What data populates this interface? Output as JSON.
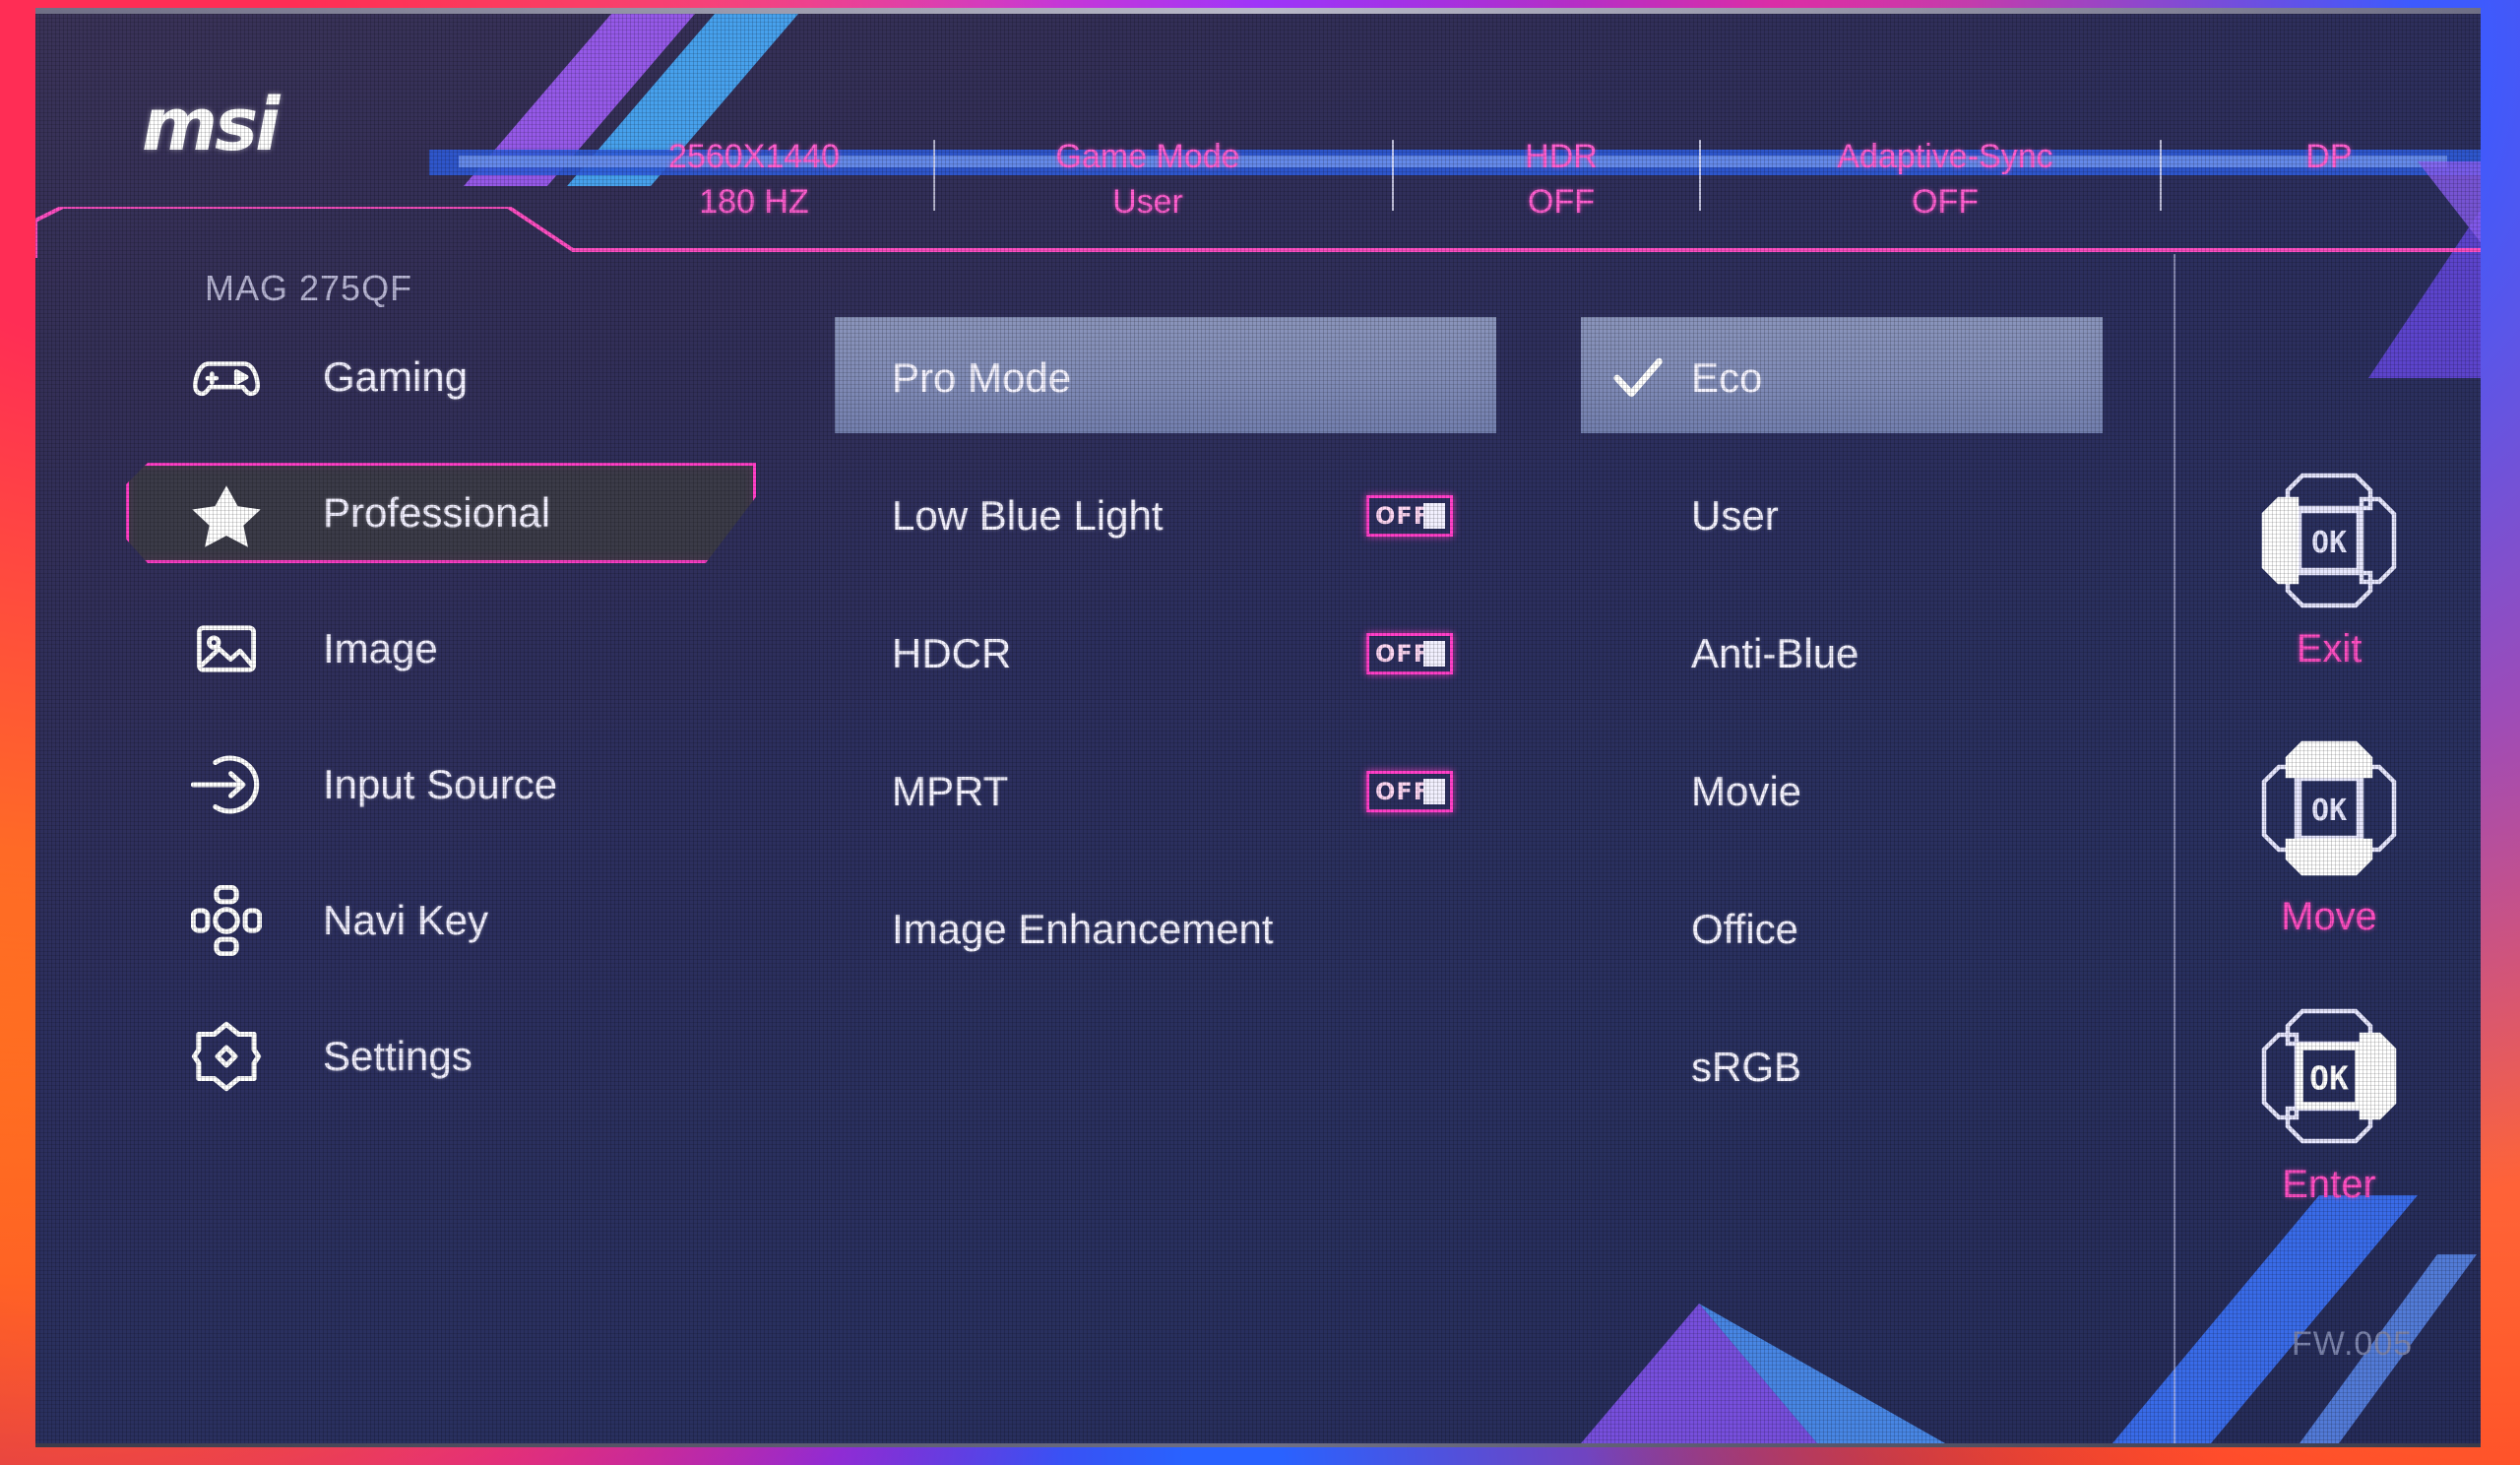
{
  "brand": {
    "logo_text": "msi"
  },
  "header": {
    "items": [
      {
        "title": "2560X1440",
        "value": "180 HZ"
      },
      {
        "title": "Game Mode",
        "value": "User"
      },
      {
        "title": "HDR",
        "value": "OFF"
      },
      {
        "title": "Adaptive-Sync",
        "value": "OFF"
      },
      {
        "title": "DP",
        "value": ""
      }
    ]
  },
  "model_name": "MAG 275QF",
  "sidebar": {
    "items": [
      {
        "label": "Gaming",
        "icon": "gamepad-icon",
        "selected": false
      },
      {
        "label": "Professional",
        "icon": "star-icon",
        "selected": true
      },
      {
        "label": "Image",
        "icon": "picture-icon",
        "selected": false
      },
      {
        "label": "Input Source",
        "icon": "input-arrow-icon",
        "selected": false
      },
      {
        "label": "Navi Key",
        "icon": "navikey-icon",
        "selected": false
      },
      {
        "label": "Settings",
        "icon": "gear-icon",
        "selected": false
      }
    ]
  },
  "options": {
    "items": [
      {
        "label": "Pro Mode",
        "highlighted": true,
        "toggle": null
      },
      {
        "label": "Low Blue Light",
        "highlighted": false,
        "toggle": "OFF"
      },
      {
        "label": "HDCR",
        "highlighted": false,
        "toggle": "OFF"
      },
      {
        "label": "MPRT",
        "highlighted": false,
        "toggle": "OFF"
      },
      {
        "label": "Image Enhancement",
        "highlighted": false,
        "toggle": null
      }
    ]
  },
  "values": {
    "items": [
      {
        "label": "Eco",
        "highlighted": true,
        "checked": true
      },
      {
        "label": "User",
        "highlighted": false,
        "checked": false
      },
      {
        "label": "Anti-Blue",
        "highlighted": false,
        "checked": false
      },
      {
        "label": "Movie",
        "highlighted": false,
        "checked": false
      },
      {
        "label": "Office",
        "highlighted": false,
        "checked": false
      },
      {
        "label": "sRGB",
        "highlighted": false,
        "checked": false
      }
    ]
  },
  "navigation": {
    "items": [
      {
        "label": "Exit",
        "icon": "navkey-left-icon",
        "center": "OK"
      },
      {
        "label": "Move",
        "icon": "navkey-updown-icon",
        "center": "OK"
      },
      {
        "label": "Enter",
        "icon": "navkey-right-icon",
        "center": "OK"
      }
    ]
  },
  "firmware": "FW.005",
  "colors": {
    "accent_pink": "#ff3fc8",
    "header_pink": "#ff5fd0",
    "panel_blue": "#2c2f5e",
    "highlight_bar": "#8e9bc6",
    "text_white": "#f4f2ff",
    "firmware_gray": "#7d85ad"
  }
}
